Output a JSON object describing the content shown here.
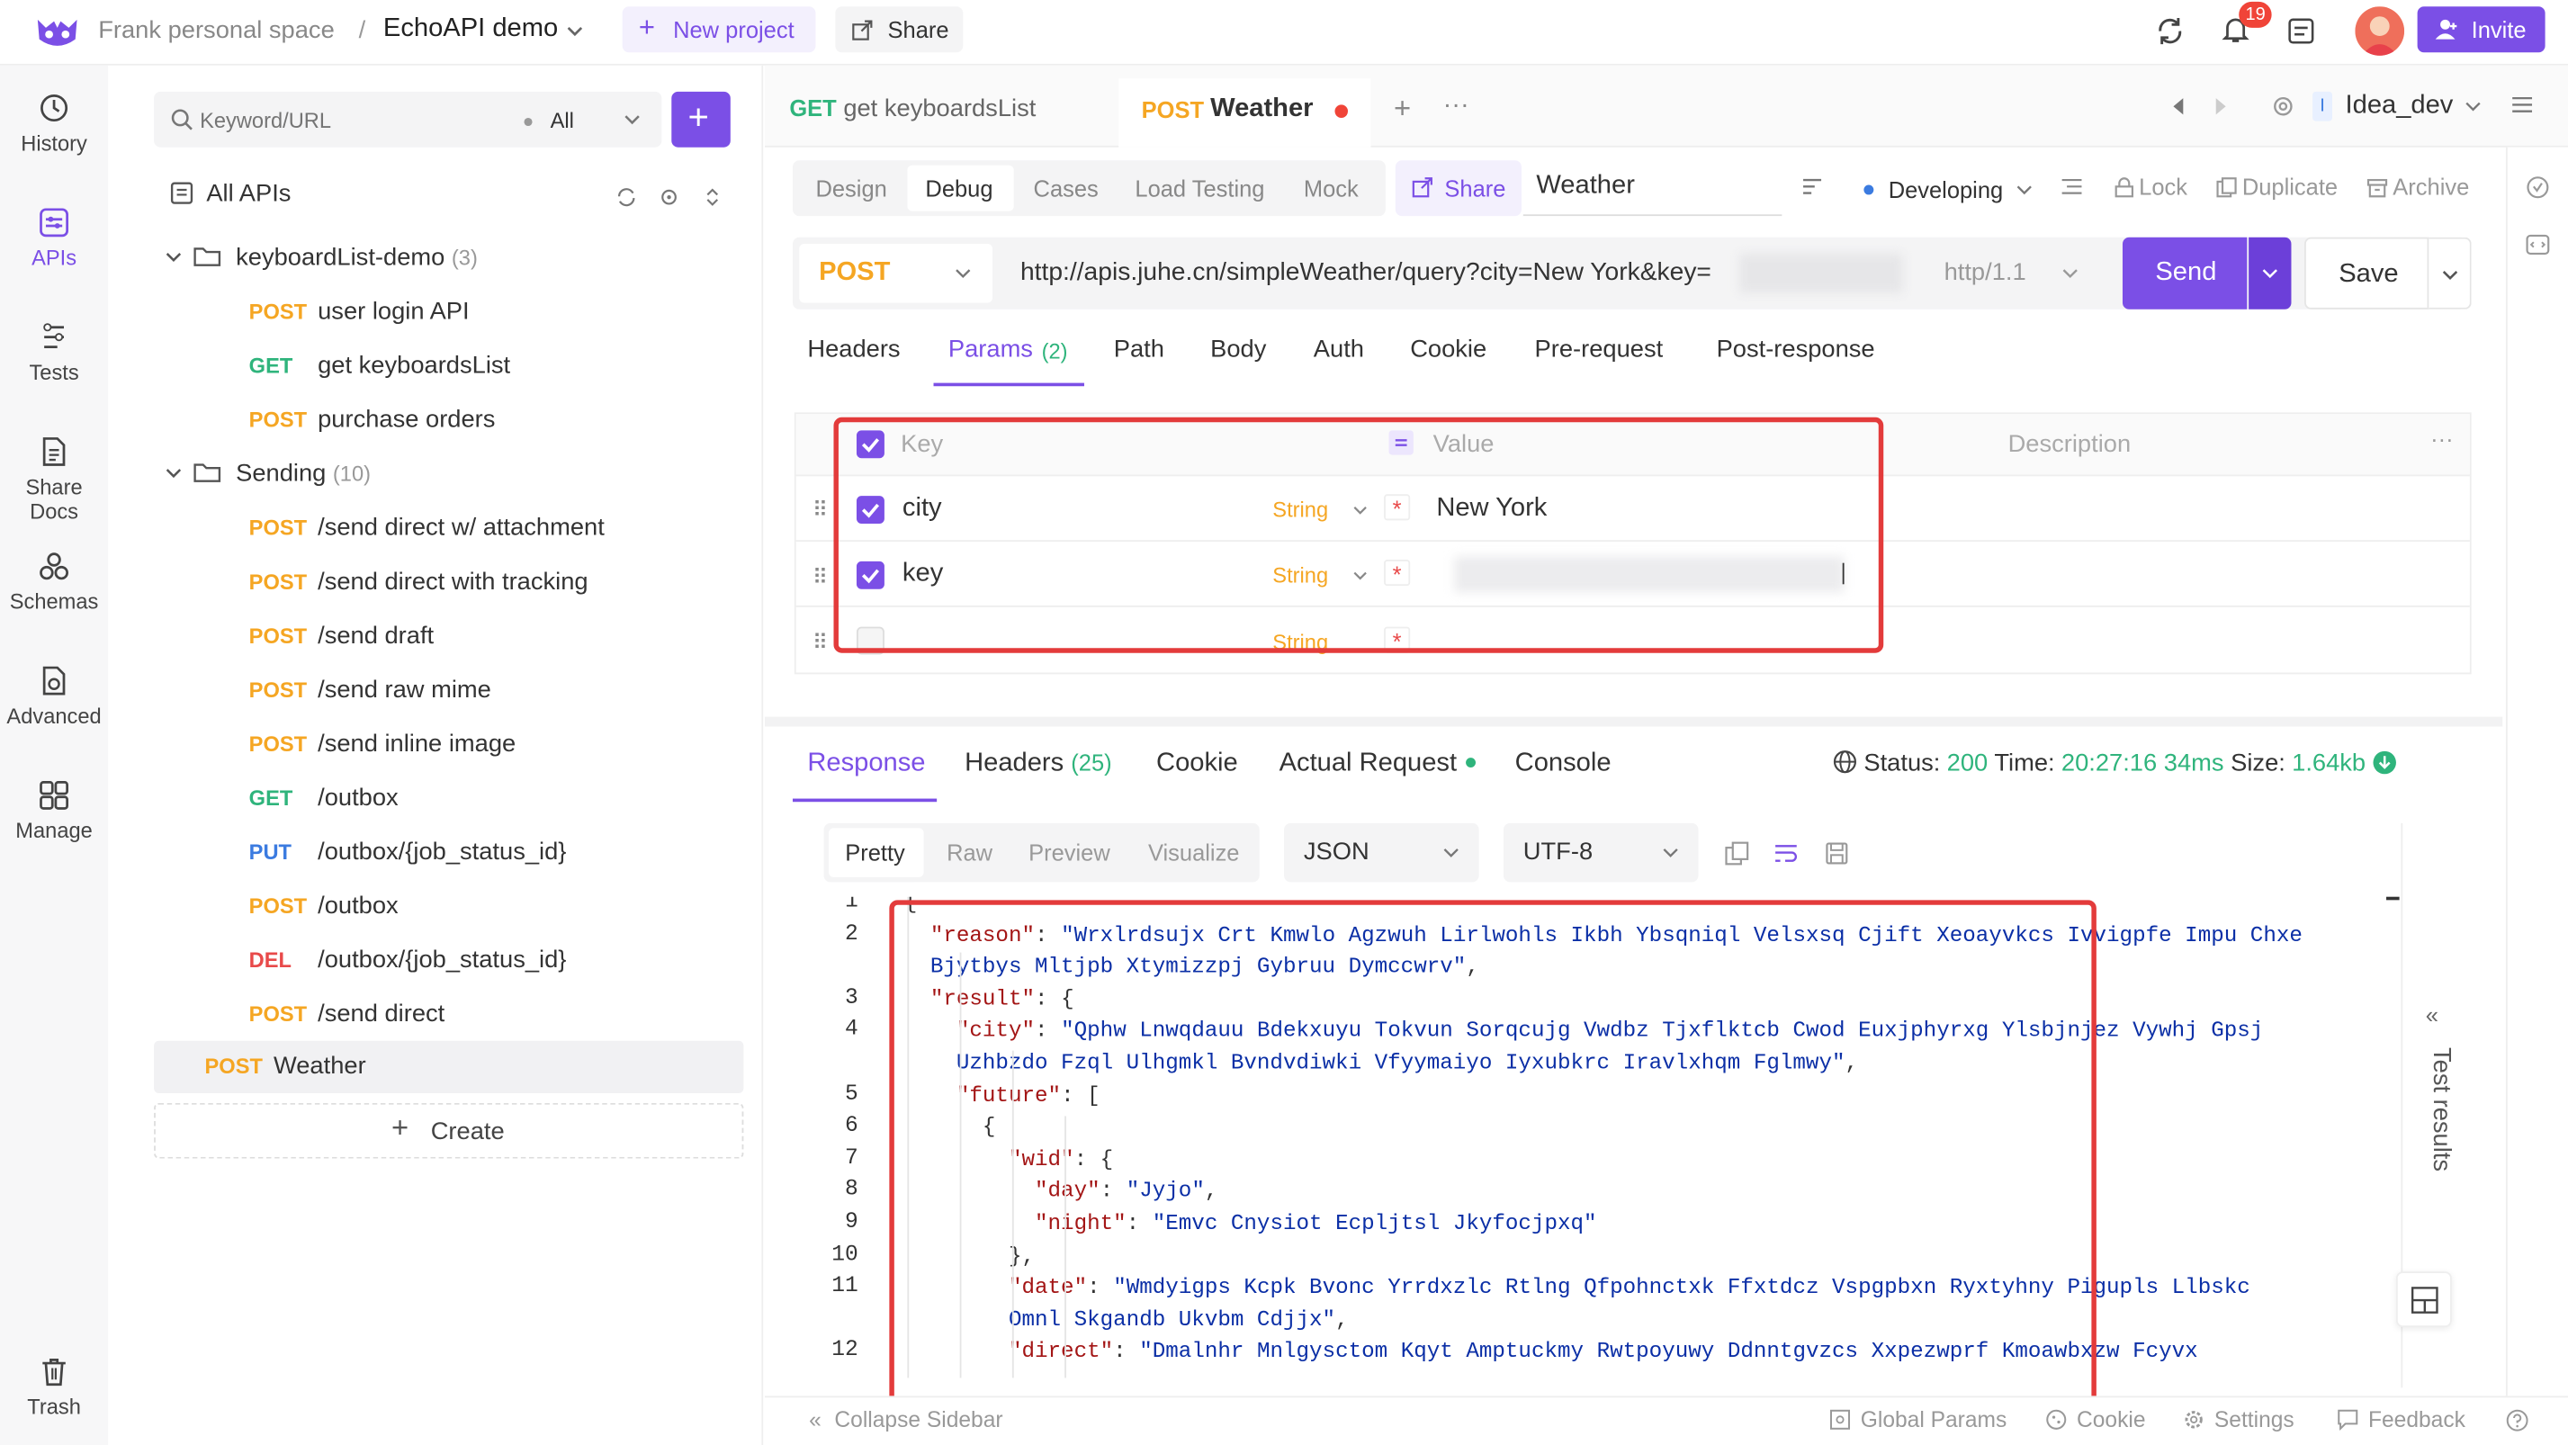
{
  "topbar": {
    "workspace": "Frank personal space",
    "separator": "/",
    "project": "EchoAPI demo",
    "new_project": "New project",
    "share": "Share",
    "notification_count": "19",
    "invite": "Invite"
  },
  "leftnav": {
    "items": [
      "History",
      "APIs",
      "Tests",
      "Share Docs",
      "Schemas",
      "Advanced",
      "Manage"
    ],
    "trash": "Trash"
  },
  "sidebar": {
    "search_placeholder": "Keyword/URL",
    "filter": "All",
    "all_apis": "All APIs",
    "folder1": {
      "name": "keyboardList-demo",
      "count": "(3)"
    },
    "folder1_items": [
      {
        "method": "POST",
        "name": "user login API"
      },
      {
        "method": "GET",
        "name": "get keyboardsList"
      },
      {
        "method": "POST",
        "name": "purchase orders"
      }
    ],
    "folder2": {
      "name": "Sending",
      "count": "(10)"
    },
    "folder2_items": [
      {
        "method": "POST",
        "name": "/send direct w/ attachment"
      },
      {
        "method": "POST",
        "name": "/send direct with tracking"
      },
      {
        "method": "POST",
        "name": "/send draft"
      },
      {
        "method": "POST",
        "name": "/send raw mime"
      },
      {
        "method": "POST",
        "name": "/send inline image"
      },
      {
        "method": "GET",
        "name": "/outbox"
      },
      {
        "method": "PUT",
        "name": "/outbox/{job_status_id}"
      },
      {
        "method": "POST",
        "name": "/outbox"
      },
      {
        "method": "DEL",
        "name": "/outbox/{job_status_id}"
      },
      {
        "method": "POST",
        "name": "/send direct"
      }
    ],
    "selected": {
      "method": "POST",
      "name": "Weather"
    },
    "create": "Create",
    "collapse": "Collapse Sidebar"
  },
  "tabs": [
    {
      "method": "GET",
      "name": "get keyboardsList"
    },
    {
      "method": "POST",
      "name": "Weather"
    }
  ],
  "env": "Idea_dev",
  "env_badge": "I",
  "modes": [
    "Design",
    "Debug",
    "Cases",
    "Load Testing",
    "Mock"
  ],
  "share": "Share",
  "api_name": "Weather",
  "status": "Developing",
  "actions": [
    "Lock",
    "Duplicate",
    "Archive"
  ],
  "request": {
    "method": "POST",
    "url": "http://apis.juhe.cn/simpleWeather/query?city=New York&key=",
    "protocol": "http/1.1",
    "send": "Send",
    "save": "Save"
  },
  "req_tabs": [
    "Headers",
    "Params",
    "Path",
    "Body",
    "Auth",
    "Cookie",
    "Pre-request",
    "Post-response"
  ],
  "params_count": "(2)",
  "params": {
    "headers": {
      "key": "Key",
      "value": "Value",
      "description": "Description"
    },
    "rows": [
      {
        "key": "city",
        "type": "String",
        "value": "New York"
      },
      {
        "key": "key",
        "type": "String",
        "value": ""
      },
      {
        "key": "",
        "type": "String",
        "value": ""
      }
    ]
  },
  "resp_tabs": [
    "Response",
    "Headers",
    "Cookie",
    "Actual Request",
    "Console"
  ],
  "resp_headers_count": "(25)",
  "resp_status": {
    "label": "Status:",
    "code": "200",
    "time_label": "Time:",
    "time": "20:27:16",
    "duration": "34ms",
    "size_label": "Size:",
    "size": "1.64kb"
  },
  "view_modes": [
    "Pretty",
    "Raw",
    "Preview",
    "Visualize"
  ],
  "format": "JSON",
  "encoding": "UTF-8",
  "test_results": "Test results",
  "code_lines": [
    {
      "n": "1",
      "html": "{"
    },
    {
      "n": "2",
      "html": "  <span class='k'>\"reason\"</span>: <span class='s'>\"Wrxlrdsujx Crt Kmwlo Agzwuh Lirlwohls Ikbh Ybsqniql Velsxsq Cjift Xeoayvkcs Ivvigpfe Impu Chxe</span>"
    },
    {
      "n": "",
      "html": "  <span class='s'>Bjytbys Mltjpb Xtymizzpj Gybruu Dymccwrv\"</span>,"
    },
    {
      "n": "3",
      "html": "  <span class='k'>\"result\"</span>: {"
    },
    {
      "n": "4",
      "html": "    <span class='k'>\"city\"</span>: <span class='s'>\"Qphw Lnwqdauu Bdekxuyu Tokvun Sorqcujg Vwdbz Tjxflktcb Cwod Euxjphyrxg Ylsbjnjez Vywhj Gpsj</span>"
    },
    {
      "n": "",
      "html": "    <span class='s'>Uzhbzdo Fzql Ulhgmkl Bvndvdiwki Vfyymaiyo Iyxubkrc Iravlxhqm Fglmwy\"</span>,"
    },
    {
      "n": "5",
      "html": "    <span class='k'>\"future\"</span>: ["
    },
    {
      "n": "6",
      "html": "      {"
    },
    {
      "n": "7",
      "html": "        <span class='k'>\"wid\"</span>: {"
    },
    {
      "n": "8",
      "html": "          <span class='k'>\"day\"</span>: <span class='s'>\"Jyjo\"</span>,"
    },
    {
      "n": "9",
      "html": "          <span class='k'>\"night\"</span>: <span class='s'>\"Emvc Cnysiot Ecpljtsl Jkyfocjpxq\"</span>"
    },
    {
      "n": "10",
      "html": "        },"
    },
    {
      "n": "11",
      "html": "        <span class='k'>\"date\"</span>: <span class='s'>\"Wmdyigps Kcpk Bvonc Yrrdxzlc Rtlng Qfpohnctxk Ffxtdcz Vspgpbxn Ryxtyhny Pigupls Llbskc</span>"
    },
    {
      "n": "",
      "html": "        <span class='s'>Omnl Skgandb Ukvbm Cdjjx\"</span>,"
    },
    {
      "n": "12",
      "html": "        <span class='k'>\"direct\"</span>: <span class='s'>\"Dmalnhr Mnlgysctom Kqyt Amptuckmy Rwtpoyuwy Ddnntgvzcs Xxpezwprf Kmoawbxzw Fcyvx</span>"
    }
  ],
  "footer": [
    "Global Params",
    "Cookie",
    "Settings",
    "Feedback"
  ],
  "colors": {
    "accent": "#7b4fe6",
    "post": "#f5a623",
    "get": "#2fb47c",
    "put": "#3b7be0",
    "del": "#e84a4a",
    "highlight": "#e33b3b"
  }
}
